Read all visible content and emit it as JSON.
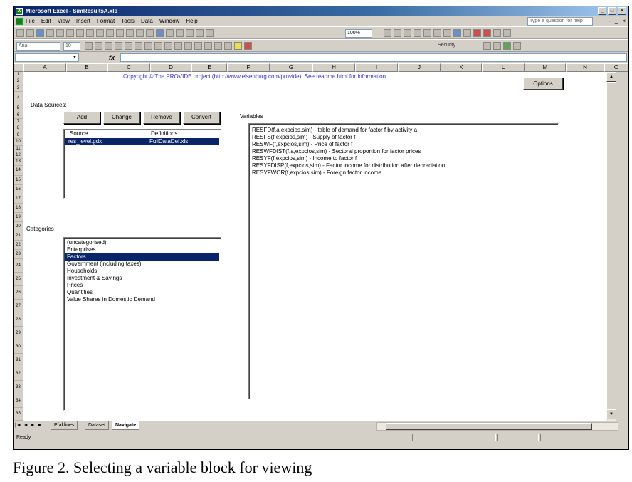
{
  "window": {
    "title": "Microsoft Excel - SimResultsA.xls",
    "controls": [
      "_",
      "□",
      "×"
    ]
  },
  "menubar": {
    "items": [
      "File",
      "Edit",
      "View",
      "Insert",
      "Format",
      "Tools",
      "Data",
      "Window",
      "Help"
    ],
    "question_box": "Type a question for help",
    "doc_controls": [
      "-",
      "_",
      "×"
    ]
  },
  "toolbar": {
    "zoom": "100%",
    "font": "Arial",
    "font_size": "10",
    "security_label": "Security..."
  },
  "formula_bar": {
    "fx": "fx"
  },
  "columns": [
    "A",
    "B",
    "C",
    "D",
    "E",
    "F",
    "G",
    "H",
    "I",
    "J",
    "K",
    "L",
    "M",
    "N",
    "O"
  ],
  "rows": [
    "1",
    "2",
    "3",
    "4",
    "5",
    "6",
    "7",
    "8",
    "9",
    "10",
    "11",
    "12",
    "13",
    "14",
    "15",
    "16",
    "17",
    "18",
    "19",
    "20",
    "21",
    "22",
    "23",
    "24",
    "25",
    "26",
    "27",
    "28",
    "29",
    "30",
    "31",
    "32",
    "33",
    "34",
    "35"
  ],
  "sheet": {
    "copyright": "Copyright © The PROVIDE project (http://www.elsenburg.com/provide). See readme.html for information.",
    "options_button": "Options",
    "data_sources_label": "Data Sources:",
    "buttons": {
      "add": "Add",
      "change": "Change",
      "remove": "Remove",
      "convert": "Convert"
    },
    "source_header": "Source",
    "definitions_header": "Definitions",
    "source_row": {
      "source": "res_level.gdx",
      "definitions": "FullDataDef.xls"
    },
    "categories_label": "Categories",
    "categories": [
      "(uncategorised)",
      "Enterprises",
      "Factors",
      "Government (including taxes)",
      "Households",
      "Investment & Savings",
      "Prices",
      "Quantities",
      "Value Shares in Domestic Demand"
    ],
    "selected_category": "Factors",
    "variables_label": "Variables",
    "variables": [
      "RESFD(f,a,expcios,sim) - table of demand for factor f by activity a",
      "RESFS(f,expcios,sim) - Supply of factor f",
      "RESWF(f,expcios,sim) - Price of factor f",
      "RESWFDIST(f,a,expcios,sim) - Sectoral proportion for factor prices",
      "RESYF(f,expcios,sim) - Income to factor f",
      "RESYFDISP(f,expcios,sim) - Factor income for distribution after depreciation",
      "RESYFWOR(f,expcios,sim) - Foreign factor income"
    ]
  },
  "tabs": {
    "items": [
      "Pfaklines",
      "Dataset",
      "Navigate"
    ],
    "active": "Navigate"
  },
  "status": {
    "text": "Ready"
  },
  "caption": "Figure 2. Selecting a variable block for viewing"
}
